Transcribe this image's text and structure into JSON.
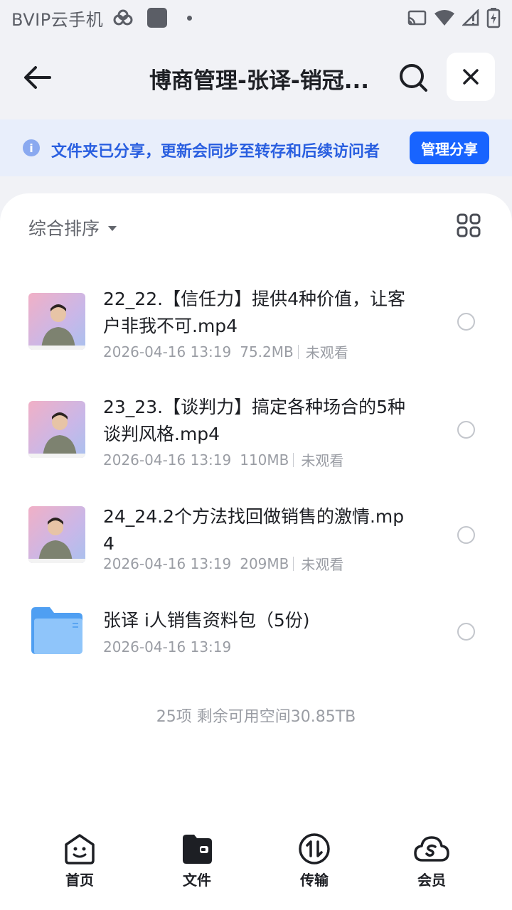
{
  "status_bar": {
    "app_name": "BVIP云手机",
    "icons": [
      "cloud-link-icon",
      "app-square-icon",
      "dot-icon",
      "cast-icon",
      "wifi-icon",
      "signal-icon",
      "battery-charging-icon"
    ]
  },
  "header": {
    "title": "博商管理-张译-销冠...",
    "back_icon": "arrow-left-icon",
    "search_icon": "search-icon",
    "close_icon": "close-icon"
  },
  "notice": {
    "icon": "info-icon",
    "text": "文件夹已分享，更新会同步至转存和后续访问者",
    "button_label": "管理分享"
  },
  "toolbar": {
    "sort_label": "综合排序",
    "grid_icon": "grid-view-icon"
  },
  "files": [
    {
      "name": "22_22.【信任力】提供4种价值，让客户非我不可.mp4",
      "date": "2026-04-16 13:19",
      "size": "75.2MB",
      "status": "未观看",
      "type": "video"
    },
    {
      "name": "23_23.【谈判力】搞定各种场合的5种谈判风格.mp4",
      "date": "2026-04-16 13:19",
      "size": "110MB",
      "status": "未观看",
      "type": "video"
    },
    {
      "name": "24_24.2个方法找回做销售的激情.mp4",
      "date": "2026-04-16 13:19",
      "size": "209MB",
      "status": "未观看",
      "type": "video"
    },
    {
      "name": "张译 i人销售资料包（5份)",
      "date": "2026-04-16 13:19",
      "type": "folder"
    }
  ],
  "summary": "25项 剩余可用空间30.85TB",
  "tabs": [
    {
      "label": "首页",
      "icon": "home-face-icon"
    },
    {
      "label": "文件",
      "icon": "folder-wallet-icon"
    },
    {
      "label": "传输",
      "icon": "transfer-icon"
    },
    {
      "label": "会员",
      "icon": "vip-cloud-icon"
    }
  ],
  "colors": {
    "accent": "#1864ff",
    "notice_bg": "#e8eefb",
    "notice_text": "#2a5fe0"
  }
}
